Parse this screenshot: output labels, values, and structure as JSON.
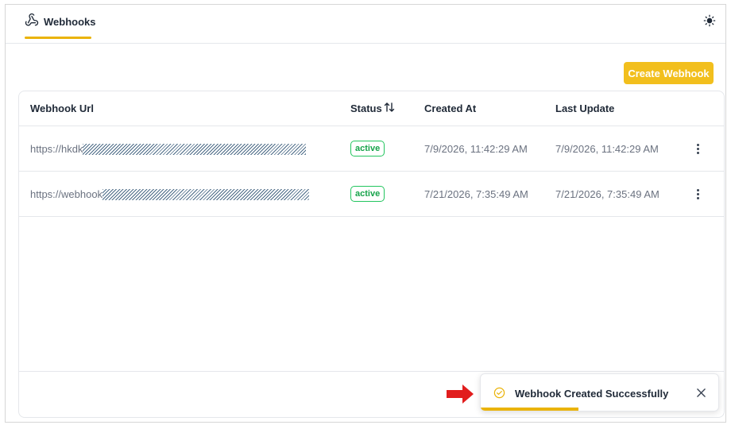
{
  "header": {
    "tab_label": "Webhooks",
    "tab_icon": "webhook-icon",
    "theme_icon": "sun-icon"
  },
  "actions": {
    "create_label": "Create Webhook",
    "accent_color": "#f2bf1d"
  },
  "table": {
    "columns": {
      "url": "Webhook Url",
      "status": "Status",
      "created": "Created At",
      "updated": "Last Update"
    },
    "sort_icon": "sort-arrows-icon",
    "rows": [
      {
        "url_prefix": "https://hkdk",
        "status": "active",
        "created_at": "7/9/2026, 11:42:29 AM",
        "last_update": "7/9/2026, 11:42:29 AM"
      },
      {
        "url_prefix": "https://webhook",
        "status": "active",
        "created_at": "7/21/2026, 7:35:49 AM",
        "last_update": "7/21/2026, 7:35:49 AM"
      }
    ],
    "row_menu_icon": "kebab-menu-icon"
  },
  "toast": {
    "message": "Webhook Created Successfully",
    "icon": "check-circle-icon",
    "close_icon": "close-icon",
    "progress": 0.41,
    "progress_color": "#eab308"
  },
  "annotation": {
    "icon": "red-arrow-icon",
    "color": "#e11d1d"
  }
}
